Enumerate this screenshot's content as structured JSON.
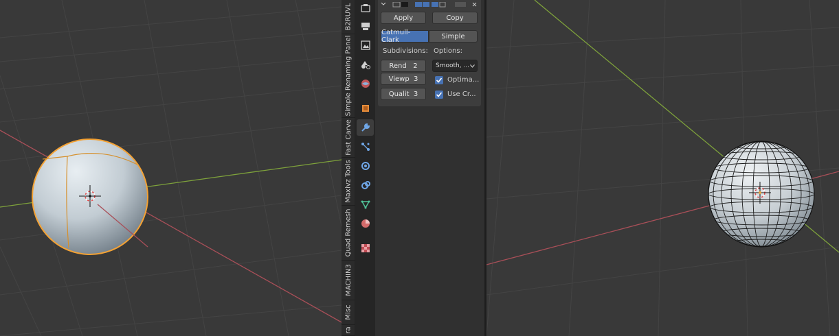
{
  "sidebar_tabs": [
    {
      "label": "B2RUVL"
    },
    {
      "label": "Simple Renaming Panel"
    },
    {
      "label": "Fast Carve"
    },
    {
      "label": "Maxivz Tools"
    },
    {
      "label": "Quad Remesh"
    },
    {
      "label": "MACHIN3"
    },
    {
      "label": "Misc"
    },
    {
      "label": "ra"
    }
  ],
  "property_icons": [
    {
      "name": "tool-icon"
    },
    {
      "name": "render-icon"
    },
    {
      "name": "output-icon"
    },
    {
      "name": "view-layer-icon"
    },
    {
      "name": "scene-icon"
    },
    {
      "name": "world-icon"
    },
    {
      "name": "object-icon"
    },
    {
      "name": "modifier-wrench-icon"
    },
    {
      "name": "particles-icon"
    },
    {
      "name": "physics-icon"
    },
    {
      "name": "constraints-icon"
    },
    {
      "name": "data-icon"
    },
    {
      "name": "material-icon"
    },
    {
      "name": "texture-icon"
    }
  ],
  "modifier": {
    "apply_label": "Apply",
    "copy_label": "Copy",
    "catmull_label": "Catmull-Clark",
    "simple_label": "Simple",
    "subdivisions_label": "Subdivisions:",
    "options_label": "Options:",
    "rend_label": "Rend",
    "rend_value": "2",
    "viewp_label": "Viewp",
    "viewp_value": "3",
    "qualit_label": "Qualit",
    "qualit_value": "3",
    "uv_smooth_value": "Smooth, ...",
    "optimal_label": "Optima...",
    "use_creases_label": "Use Cr..."
  },
  "colors": {
    "viewport_bg": "#393939",
    "x_axis": "#a94f58",
    "y_axis": "#7ea23b",
    "selection": "#f4a234",
    "accent": "#4772b3"
  }
}
